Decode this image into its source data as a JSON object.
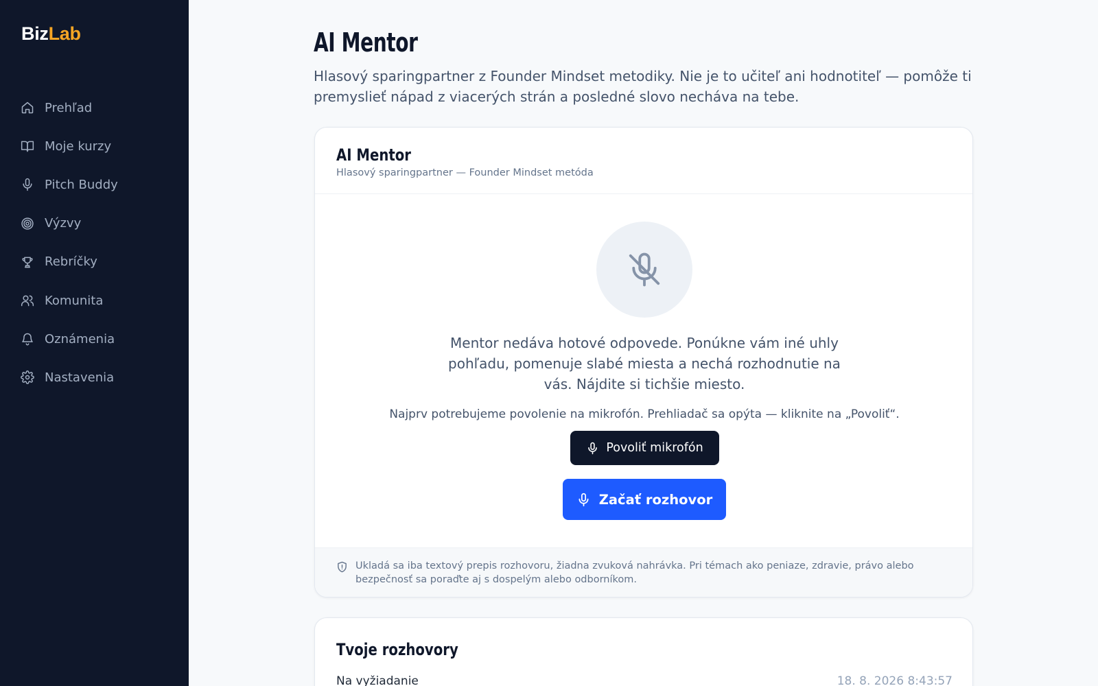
{
  "brand": {
    "part1": "Biz",
    "part2": "Lab",
    "accent_color": "#f5a524"
  },
  "sidebar": {
    "items": [
      {
        "label": "Prehľad",
        "icon": "home-icon"
      },
      {
        "label": "Moje kurzy",
        "icon": "book-icon"
      },
      {
        "label": "Pitch Buddy",
        "icon": "mic-icon"
      },
      {
        "label": "Výzvy",
        "icon": "target-icon"
      },
      {
        "label": "Rebríčky",
        "icon": "trophy-icon"
      },
      {
        "label": "Komunita",
        "icon": "users-icon"
      },
      {
        "label": "Oznámenia",
        "icon": "bell-icon"
      },
      {
        "label": "Nastavenia",
        "icon": "gear-icon"
      }
    ]
  },
  "page": {
    "title": "AI Mentor",
    "description": "Hlasový sparingpartner z Founder Mindset metodiky. Nie je to učiteľ ani hodnotiteľ — pomôže ti premyslieť nápad z viacerých strán a posledné slovo necháva na tebe."
  },
  "mentor_card": {
    "title": "AI Mentor",
    "subtitle": "Hlasový sparingpartner — Founder Mindset metóda",
    "mic_icon": "mic-off-icon",
    "intro": "Mentor nedáva hotové odpovede. Ponúkne vám iné uhly pohľadu, pomenuje slabé miesta a nechá rozhodnutie na vás. Nájdite si tichšie miesto.",
    "permission_text": "Najprv potrebujeme povolenie na mikrofón. Prehliadač sa opýta — kliknite na „Povoliť“.",
    "allow_button": "Povoliť mikrofón",
    "start_button": "Začať rozhovor",
    "footer_note": "Ukladá sa iba textový prepis rozhovoru, žiadna zvuková nahrávka. Pri témach ako peniaze, zdravie, právo alebo bezpečnosť sa poraďte aj s dospelým alebo odborníkom.",
    "colors": {
      "primary_button": "#1e5bff",
      "dark_button": "#0f172a"
    }
  },
  "conversations": {
    "title": "Tvoje rozhovory",
    "items": [
      {
        "title": "Na vyžiadanie",
        "time": "18. 8. 2026 8:43:57"
      }
    ]
  }
}
